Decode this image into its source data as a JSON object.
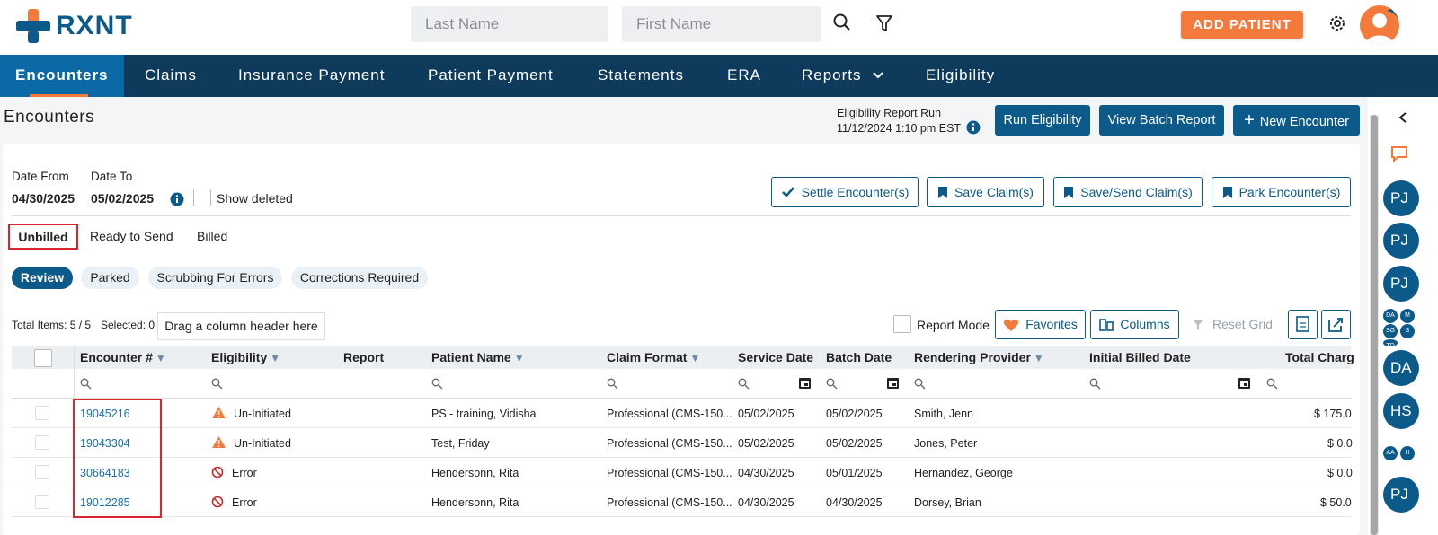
{
  "app": {
    "logo_text": "RXNT",
    "brand_color": "#0b5a8a",
    "accent_color": "#f47a3c"
  },
  "search": {
    "last_name_placeholder": "Last Name",
    "first_name_placeholder": "First Name"
  },
  "header": {
    "add_patient_label": "ADD PATIENT"
  },
  "nav": [
    {
      "label": "Encounters",
      "active": true
    },
    {
      "label": "Claims"
    },
    {
      "label": "Insurance Payment"
    },
    {
      "label": "Patient Payment"
    },
    {
      "label": "Statements"
    },
    {
      "label": "ERA"
    },
    {
      "label": "Reports"
    },
    {
      "label": "Eligibility"
    }
  ],
  "page": {
    "title": "Encounters",
    "eligibility_run_label": "Eligibility Report Run",
    "eligibility_run_time": "11/12/2024 1:10 pm EST",
    "run_eligibility_label": "Run Eligibility",
    "view_batch_label": "View Batch Report",
    "new_encounter_label": "New Encounter"
  },
  "filters": {
    "date_from_label": "Date From",
    "date_from_value": "04/30/2025",
    "date_to_label": "Date To",
    "date_to_value": "05/02/2025",
    "show_deleted_label": "Show deleted"
  },
  "actions": {
    "settle": "Settle Encounter(s)",
    "save_claim": "Save Claim(s)",
    "save_send": "Save/Send Claim(s)",
    "park": "Park Encounter(s)"
  },
  "tabs": [
    "Unbilled",
    "Ready to Send",
    "Billed"
  ],
  "pills": [
    "Review",
    "Parked",
    "Scrubbing For Errors",
    "Corrections Required"
  ],
  "grid_toolbar": {
    "total_items": "Total Items: 5 / 5",
    "selected": "Selected: 0",
    "drag_hint": "Drag a column header here",
    "report_mode": "Report Mode",
    "favorites": "Favorites",
    "columns": "Columns",
    "reset_grid": "Reset Grid"
  },
  "columns": [
    "Encounter #",
    "Eligibility",
    "Report",
    "Patient Name",
    "Claim Format",
    "Service Date",
    "Batch Date",
    "Rendering Provider",
    "Initial Billed Date",
    "Total Charg"
  ],
  "rows": [
    {
      "encounter": "19045216",
      "eligibility": "Un-Initiated",
      "patient": "PS - training, Vidisha",
      "format": "Professional (CMS-150...",
      "service": "05/02/2025",
      "batch": "05/02/2025",
      "provider": "Smith, Jenn",
      "total": "$ 175.0"
    },
    {
      "encounter": "19043304",
      "eligibility": "Un-Initiated",
      "patient": "Test, Friday",
      "format": "Professional (CMS-150...",
      "service": "05/02/2025",
      "batch": "05/02/2025",
      "provider": "Jones, Peter",
      "total": "$ 0.0"
    },
    {
      "encounter": "30664183",
      "eligibility": "Error",
      "patient": "Hendersonn, Rita",
      "format": "Professional (CMS-150...",
      "service": "04/30/2025",
      "batch": "05/01/2025",
      "provider": "Hernandez, George",
      "total": "$ 0.0"
    },
    {
      "encounter": "19012285",
      "eligibility": "Error",
      "patient": "Hendersonn, Rita",
      "format": "Professional (CMS-150...",
      "service": "04/30/2025",
      "batch": "04/30/2025",
      "provider": "Dorsey, Brian",
      "total": "$ 50.0"
    }
  ],
  "rail": {
    "avatars": [
      "PJ",
      "PJ",
      "PJ",
      "DA",
      "HS",
      "PJ"
    ],
    "mini": [
      "DA",
      "M",
      "SG",
      "S",
      "TD",
      "AA",
      "H"
    ]
  }
}
